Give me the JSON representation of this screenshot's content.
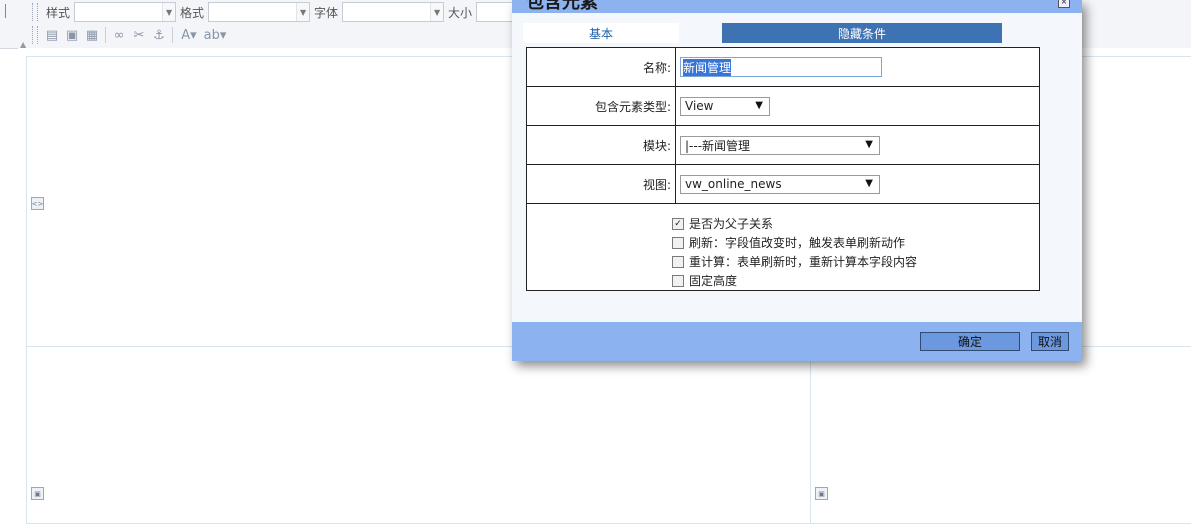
{
  "toolbar": {
    "style_label": "样式",
    "format_label": "格式",
    "font_label": "字体",
    "size_label": "大小",
    "style_value": "",
    "format_value": "",
    "font_value": "",
    "size_value": "",
    "icons": [
      "template-icon",
      "source-icon",
      "preview-icon",
      "link-icon",
      "unlink-icon",
      "anchor-icon",
      "text-color-icon",
      "bg-color-icon"
    ]
  },
  "dialog": {
    "title": "包含元素",
    "tabs": [
      {
        "label": "基本",
        "active": true
      },
      {
        "label": "隐藏条件",
        "active": false
      }
    ],
    "fields": {
      "name_label": "名称:",
      "name_value": "新闻管理",
      "type_label": "包含元素类型:",
      "type_value": "View",
      "module_label": "模块:",
      "module_value": "|---新闻管理",
      "view_label": "视图:",
      "view_value": "vw_online_news"
    },
    "checkboxes": [
      {
        "label": "是否为父子关系",
        "checked": true
      },
      {
        "label": "刷新：字段值改变时，触发表单刷新动作",
        "checked": false
      },
      {
        "label": "重计算：表单刷新时，重新计算本字段内容",
        "checked": false
      },
      {
        "label": "固定高度",
        "checked": false
      }
    ],
    "ok_label": "确定",
    "cancel_label": "取消"
  },
  "colors": {
    "dialog_frame": "#8db2f0",
    "tab_active_text": "#1f5fa8",
    "tab_inactive_bg": "#3d72b3",
    "button_bg": "#6b98df"
  }
}
